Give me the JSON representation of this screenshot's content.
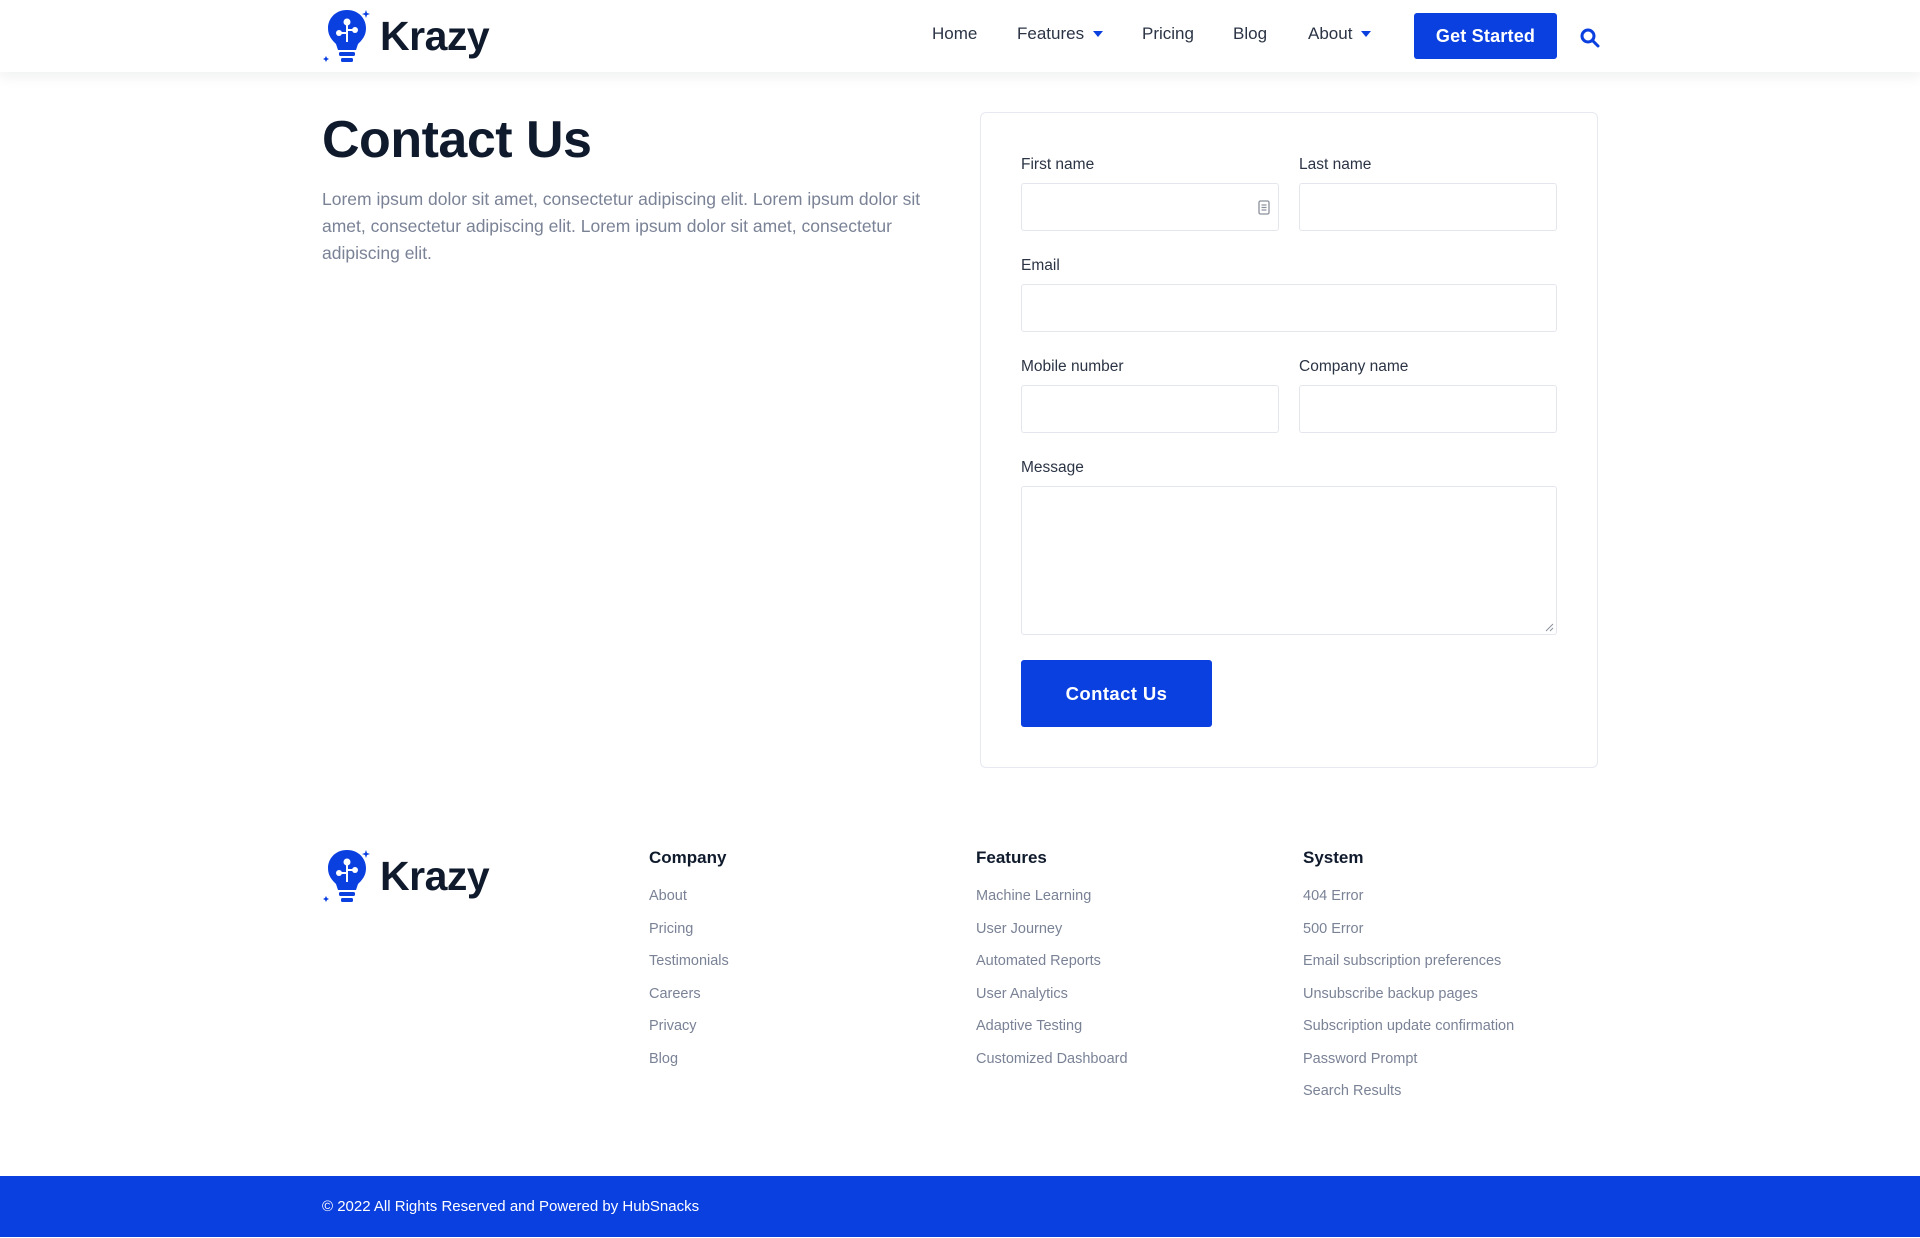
{
  "brand": {
    "name": "Krazy",
    "accent_color": "#0a3fe0"
  },
  "nav": {
    "items": [
      {
        "label": "Home",
        "has_dropdown": false
      },
      {
        "label": "Features",
        "has_dropdown": true
      },
      {
        "label": "Pricing",
        "has_dropdown": false
      },
      {
        "label": "Blog",
        "has_dropdown": false
      },
      {
        "label": "About",
        "has_dropdown": true
      }
    ],
    "cta_label": "Get Started",
    "search_icon": "search-icon"
  },
  "intro": {
    "title": "Contact Us",
    "text": "Lorem ipsum dolor sit amet, consectetur adipiscing elit. Lorem ipsum dolor sit amet, consectetur adipiscing elit. Lorem ipsum dolor sit amet, consectetur adipiscing elit."
  },
  "form": {
    "first_name": {
      "label": "First name",
      "value": ""
    },
    "last_name": {
      "label": "Last name",
      "value": ""
    },
    "email": {
      "label": "Email",
      "value": ""
    },
    "mobile": {
      "label": "Mobile number",
      "value": ""
    },
    "company": {
      "label": "Company name",
      "value": ""
    },
    "message": {
      "label": "Message",
      "value": ""
    },
    "submit_label": "Contact Us"
  },
  "footer": {
    "columns": [
      {
        "heading": "Company",
        "links": [
          "About",
          "Pricing",
          "Testimonials",
          "Careers",
          "Privacy",
          "Blog"
        ]
      },
      {
        "heading": "Features",
        "links": [
          "Machine Learning",
          "User Journey",
          "Automated Reports",
          "User Analytics",
          "Adaptive Testing",
          "Customized Dashboard"
        ]
      },
      {
        "heading": "System",
        "links": [
          "404 Error",
          "500 Error",
          "Email subscription preferences",
          "Unsubscribe backup pages",
          "Subscription update confirmation",
          "Password Prompt",
          "Search Results"
        ]
      }
    ],
    "copyright": "© 2022 All Rights Reserved and Powered by HubSnacks"
  }
}
